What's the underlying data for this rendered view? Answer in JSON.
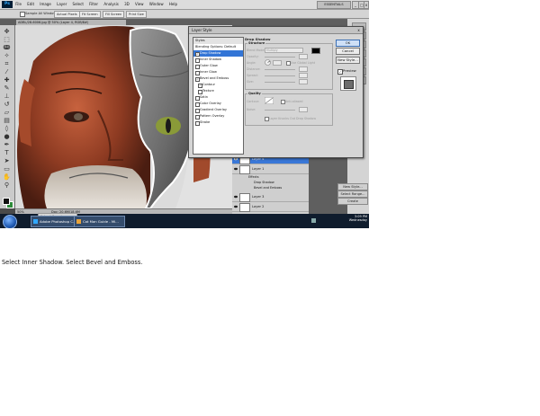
{
  "menu": {
    "app_badge": "Ps",
    "items": [
      "File",
      "Edit",
      "Image",
      "Layer",
      "Select",
      "Filter",
      "Analysis",
      "3D",
      "View",
      "Window",
      "Help"
    ],
    "workspace": "ESSENTIALS",
    "win_min": "_",
    "win_max": "□",
    "win_close": "x"
  },
  "options": {
    "sample_all_windows": "Sample All Windows",
    "actual_pixels": "Actual Pixels",
    "fit_screen": "Fit Screen",
    "fill_screen": "Fill Screen",
    "print_size": "Print Size"
  },
  "document": {
    "tab_title": "ADBL/28-6006.jpg @ 50% (Layer 4, RGB/8#)",
    "zoom": "50%",
    "doc_size": "Doc: 20.6M/18.6M"
  },
  "dialog": {
    "title": "Layer Style",
    "close": "x",
    "styles_header": "Styles",
    "blending": "Blending Options: Default",
    "items": [
      {
        "label": "Drop Shadow",
        "checked": true,
        "selected": true,
        "sub": false
      },
      {
        "label": "Inner Shadow",
        "checked": false,
        "selected": false,
        "sub": false
      },
      {
        "label": "Outer Glow",
        "checked": false,
        "selected": false,
        "sub": false
      },
      {
        "label": "Inner Glow",
        "checked": false,
        "selected": false,
        "sub": false
      },
      {
        "label": "Bevel and Emboss",
        "checked": true,
        "selected": false,
        "sub": false
      },
      {
        "label": "Contour",
        "checked": true,
        "selected": false,
        "sub": true
      },
      {
        "label": "Texture",
        "checked": false,
        "selected": false,
        "sub": true
      },
      {
        "label": "Satin",
        "checked": false,
        "selected": false,
        "sub": false
      },
      {
        "label": "Color Overlay",
        "checked": false,
        "selected": false,
        "sub": false
      },
      {
        "label": "Gradient Overlay",
        "checked": false,
        "selected": false,
        "sub": false
      },
      {
        "label": "Pattern Overlay",
        "checked": false,
        "selected": false,
        "sub": false
      },
      {
        "label": "Stroke",
        "checked": false,
        "selected": false,
        "sub": false
      }
    ],
    "section_title": "Drop Shadow",
    "structure": "Structure",
    "blend_mode_label": "Blend Mode:",
    "blend_mode_value": "Multiply",
    "opacity_label": "Opacity:",
    "angle_label": "Angle:",
    "use_global_light": "Use Global Light",
    "distance_label": "Distance:",
    "spread_label": "Spread:",
    "size_label": "Size:",
    "quality": "Quality",
    "contour_label": "Contour:",
    "anti_aliased": "Anti-aliased",
    "noise_label": "Noise:",
    "layer_knocks_out": "Layer Knocks Out Drop Shadow",
    "ok": "OK",
    "cancel": "Cancel",
    "new_style": "New Style...",
    "preview": "Preview"
  },
  "layers": {
    "rows": [
      {
        "label": "Layer 4",
        "selected": true
      },
      {
        "label": "Layer 1",
        "selected": false
      }
    ],
    "effects": "Effects",
    "drop_shadow": "Drop Shadow",
    "bevel": "Bevel and Emboss",
    "rows2": [
      {
        "label": "Layer 3"
      },
      {
        "label": "Layer 2"
      }
    ],
    "btns": [
      "New Style...",
      "Select Range...",
      "Create"
    ]
  },
  "taskbar": {
    "yahoo": "Yahoo! Search",
    "buttons": [
      "Adobe Photoshop C...",
      "Cat Man Guide - Mi..."
    ],
    "time": "3:09 PM",
    "day": "Wednesday"
  },
  "caption": "Select Inner Shadow. Select Bevel and Emboss.",
  "colors": {
    "selection": "#3375d6",
    "taskbar": "#0f1c2d",
    "foreground": "#111111",
    "background_swatch": "#2e8b3a"
  }
}
